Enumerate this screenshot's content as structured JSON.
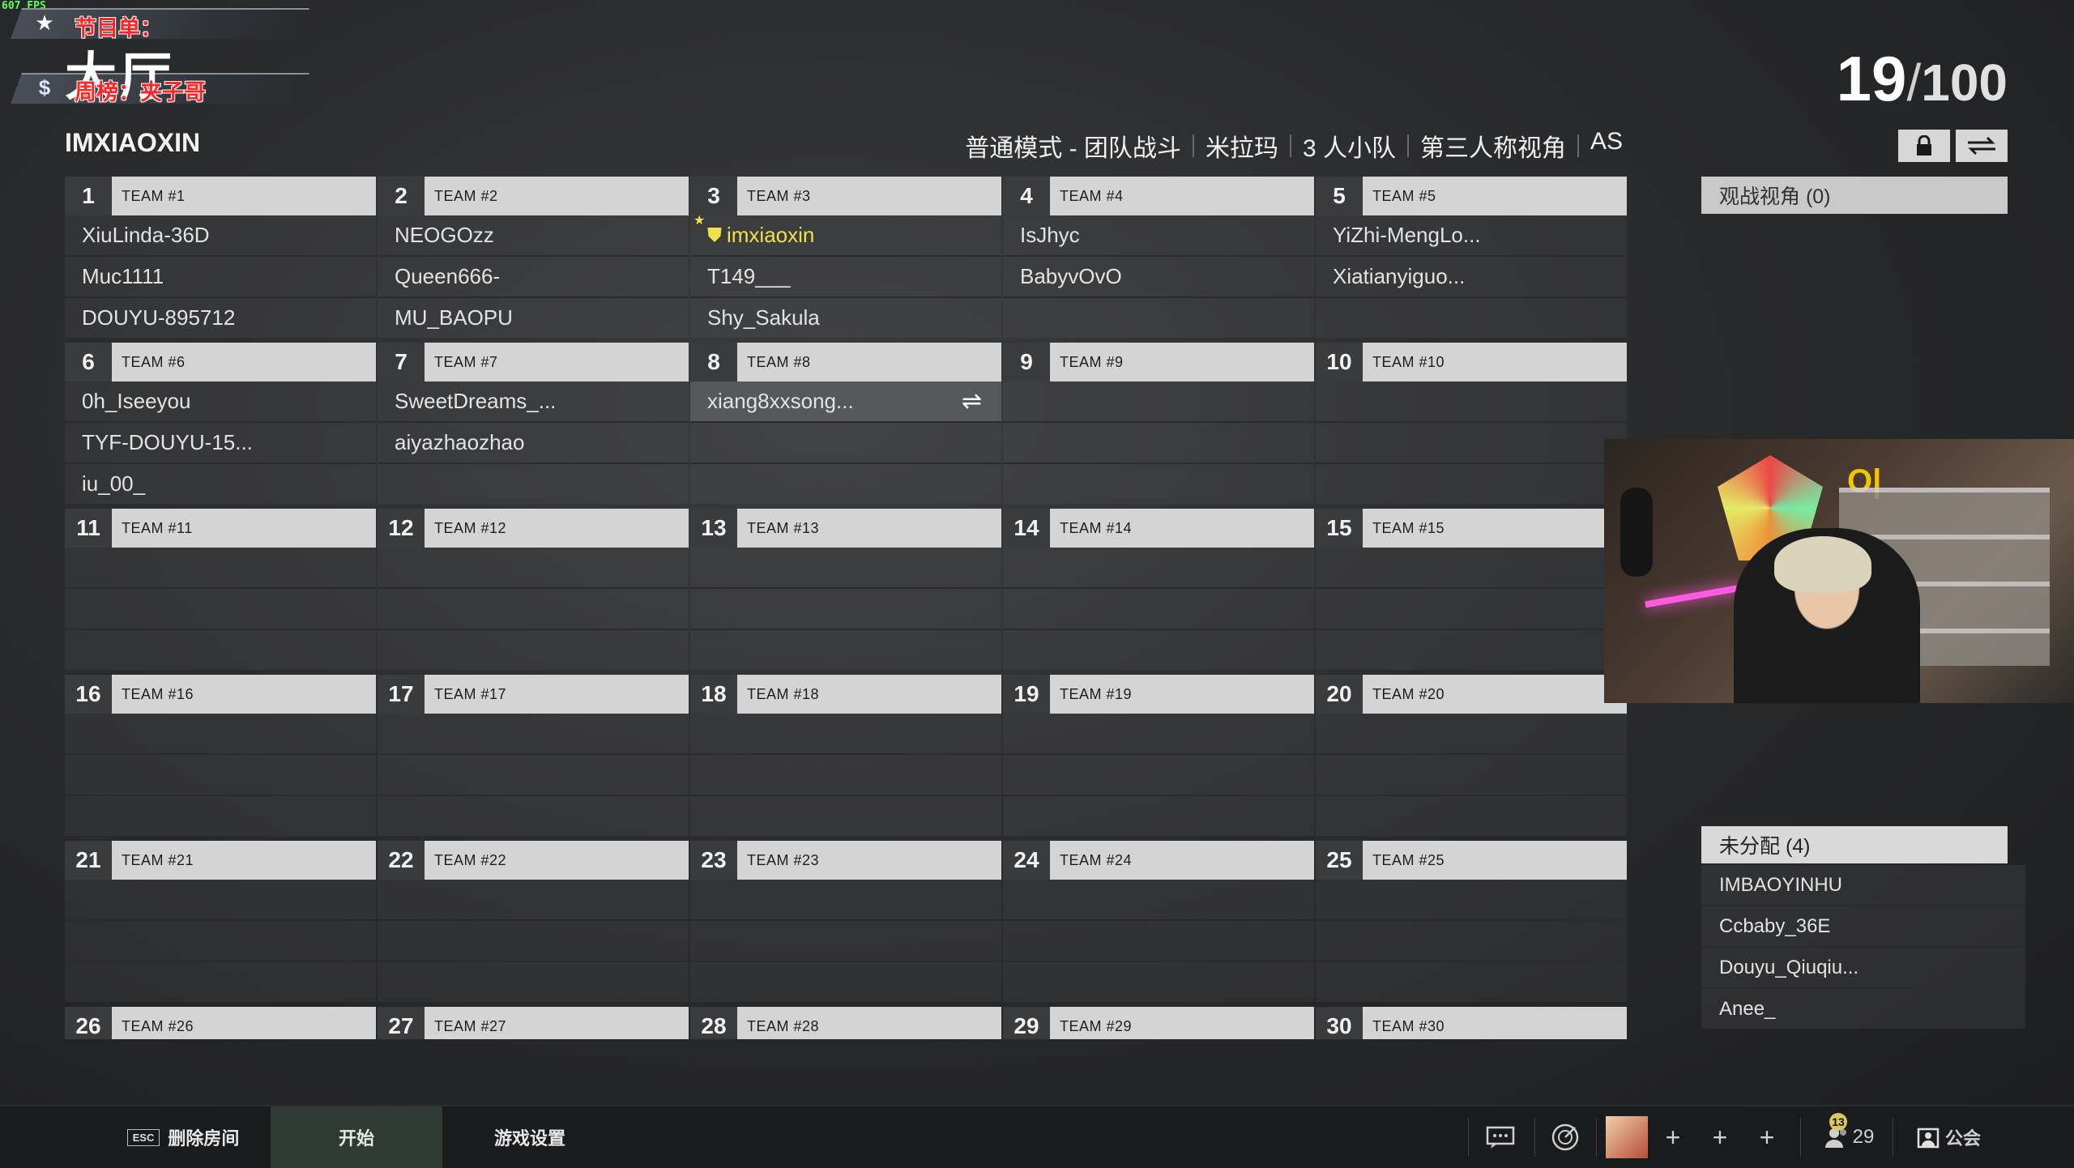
{
  "fps": "607 FPS",
  "overlay": {
    "line1": "节目单：",
    "big": "大厅",
    "line2": "周榜：夹子哥"
  },
  "counter": {
    "current": "19",
    "separator": "/",
    "max": "100"
  },
  "lobby": {
    "host": "IMXIAOXIN",
    "modes": [
      "普通模式 - 团队战斗",
      "米拉玛",
      "3 人小队",
      "第三人称视角",
      "AS"
    ]
  },
  "teams": [
    {
      "num": "1",
      "name": "TEAM #1",
      "players": [
        "XiuLinda-36D",
        "Muc1111",
        "DOUYU-895712"
      ]
    },
    {
      "num": "2",
      "name": "TEAM #2",
      "players": [
        "NEOGOzz",
        "Queen666-",
        "MU_BAOPU"
      ]
    },
    {
      "num": "3",
      "name": "TEAM #3",
      "players": [
        "imxiaoxin",
        "T149___",
        "Shy_Sakula"
      ]
    },
    {
      "num": "4",
      "name": "TEAM #4",
      "players": [
        "IsJhyc",
        "BabyvOvO",
        ""
      ]
    },
    {
      "num": "5",
      "name": "TEAM #5",
      "players": [
        "YiZhi-MengLo...",
        "Xiatianyiguo...",
        ""
      ]
    },
    {
      "num": "6",
      "name": "TEAM #6",
      "players": [
        "0h_Iseeyou",
        "TYF-DOUYU-15...",
        "iu_00_"
      ]
    },
    {
      "num": "7",
      "name": "TEAM #7",
      "players": [
        "SweetDreams_...",
        "aiyazhaozhao",
        ""
      ]
    },
    {
      "num": "8",
      "name": "TEAM #8",
      "players": [
        "xiang8xxsong...",
        "",
        ""
      ]
    },
    {
      "num": "9",
      "name": "TEAM #9",
      "players": [
        "",
        "",
        ""
      ]
    },
    {
      "num": "10",
      "name": "TEAM #10",
      "players": [
        "",
        "",
        ""
      ]
    },
    {
      "num": "11",
      "name": "TEAM #11",
      "players": [
        "",
        "",
        ""
      ]
    },
    {
      "num": "12",
      "name": "TEAM #12",
      "players": [
        "",
        "",
        ""
      ]
    },
    {
      "num": "13",
      "name": "TEAM #13",
      "players": [
        "",
        "",
        ""
      ]
    },
    {
      "num": "14",
      "name": "TEAM #14",
      "players": [
        "",
        "",
        ""
      ]
    },
    {
      "num": "15",
      "name": "TEAM #15",
      "players": [
        "",
        "",
        ""
      ]
    },
    {
      "num": "16",
      "name": "TEAM #16",
      "players": [
        "",
        "",
        ""
      ]
    },
    {
      "num": "17",
      "name": "TEAM #17",
      "players": [
        "",
        "",
        ""
      ]
    },
    {
      "num": "18",
      "name": "TEAM #18",
      "players": [
        "",
        "",
        ""
      ]
    },
    {
      "num": "19",
      "name": "TEAM #19",
      "players": [
        "",
        "",
        ""
      ]
    },
    {
      "num": "20",
      "name": "TEAM #20",
      "players": [
        "",
        "",
        ""
      ]
    },
    {
      "num": "21",
      "name": "TEAM #21",
      "players": [
        "",
        "",
        ""
      ]
    },
    {
      "num": "22",
      "name": "TEAM #22",
      "players": [
        "",
        "",
        ""
      ]
    },
    {
      "num": "23",
      "name": "TEAM #23",
      "players": [
        "",
        "",
        ""
      ]
    },
    {
      "num": "24",
      "name": "TEAM #24",
      "players": [
        "",
        "",
        ""
      ]
    },
    {
      "num": "25",
      "name": "TEAM #25",
      "players": [
        "",
        "",
        ""
      ]
    },
    {
      "num": "26",
      "name": "TEAM #26",
      "players": []
    },
    {
      "num": "27",
      "name": "TEAM #27",
      "players": []
    },
    {
      "num": "28",
      "name": "TEAM #28",
      "players": []
    },
    {
      "num": "29",
      "name": "TEAM #29",
      "players": []
    },
    {
      "num": "30",
      "name": "TEAM #30",
      "players": []
    }
  ],
  "spectator": {
    "label": "观战视角 (0)"
  },
  "unassigned": {
    "label": "未分配 (4)",
    "players": [
      "IMBAOYINHU",
      "Ccbaby_36E",
      "Douyu_Qiuqiu...",
      "Anee_"
    ]
  },
  "bottom": {
    "esc_key": "ESC",
    "delete_label": "删除房间",
    "start_label": "开始",
    "settings_label": "游戏设置",
    "friends_online": "13",
    "friends_count": "29",
    "guild_label": "公会"
  },
  "icons": {
    "lock": "lock-icon",
    "swap": "swap-icon",
    "self_marker": "shield-icon",
    "chat": "chat-icon",
    "radar": "radar-icon",
    "friends": "friends-icon",
    "guild": "guild-icon"
  },
  "colors": {
    "self_highlight": "#f3e04a",
    "header_bg": "#d4d4d4",
    "fps_green": "#5cff5c"
  }
}
